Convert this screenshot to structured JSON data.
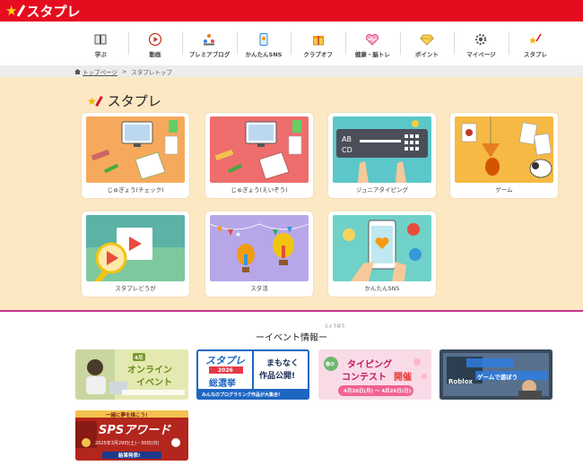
{
  "header": {
    "logo_text": "スタプレ"
  },
  "nav": [
    {
      "label": "学ぶ",
      "icon": "book-icon"
    },
    {
      "label": "動画",
      "icon": "play-icon"
    },
    {
      "label": "プレミアブログ",
      "icon": "people-icon"
    },
    {
      "label": "かんたんSNS",
      "icon": "phone-icon"
    },
    {
      "label": "クラブオフ",
      "icon": "gift-icon"
    },
    {
      "label": "健康・脳トレ",
      "icon": "heart-icon"
    },
    {
      "label": "ポイント",
      "icon": "diamond-icon"
    },
    {
      "label": "マイページ",
      "icon": "gear-icon"
    },
    {
      "label": "スタプレ",
      "icon": "star-pen-icon"
    }
  ],
  "breadcrumb": {
    "home": "トップページ",
    "separator": ">",
    "current": "スタプレトップ"
  },
  "main": {
    "title": "スタプレ",
    "cards": [
      {
        "label": "じゅぎょう(チェック)",
        "bg": "#f6a95c"
      },
      {
        "label": "じゅぎょう(えいぞう)",
        "bg": "#ee6d6d"
      },
      {
        "label": "ジュニアタイピング",
        "bg": "#5cc7c9"
      },
      {
        "label": "ゲーム",
        "bg": "#f5b944"
      },
      {
        "label": "スタプレどうが",
        "bg": "#7ec8a0"
      },
      {
        "label": "スタ活",
        "bg": "#b7a7e8"
      },
      {
        "label": "かんたんSNS",
        "bg": "#6fd1c8"
      }
    ]
  },
  "events": {
    "title": "ーイベント情報ー",
    "ruby": "じょうほう",
    "banners": [
      {
        "name": "online-event",
        "line1": "4月",
        "line2": "オンライン",
        "line3": "イベント"
      },
      {
        "name": "election",
        "line1": "スタプレ",
        "line2": "2026",
        "line3": "総選挙",
        "line4": "まもなく",
        "line5": "作品公開!",
        "line6": "みんなのプログラミング作品が大集合!"
      },
      {
        "name": "typing-contest",
        "line1": "春の",
        "line2": "タイピング",
        "line3": "コンテスト",
        "line4": "開催",
        "line5": "4月20日(月) ～ 4月26日(日)"
      },
      {
        "name": "roblox",
        "line1": "Roblox",
        "line2": "ゲームで遊ぼう"
      },
      {
        "name": "sps-award",
        "line1": "一緒に夢を描こう!",
        "line2": "SPSアワード",
        "line3": "2025年3月29日(土)・30日(日)",
        "line4": "結果発表!"
      }
    ]
  }
}
